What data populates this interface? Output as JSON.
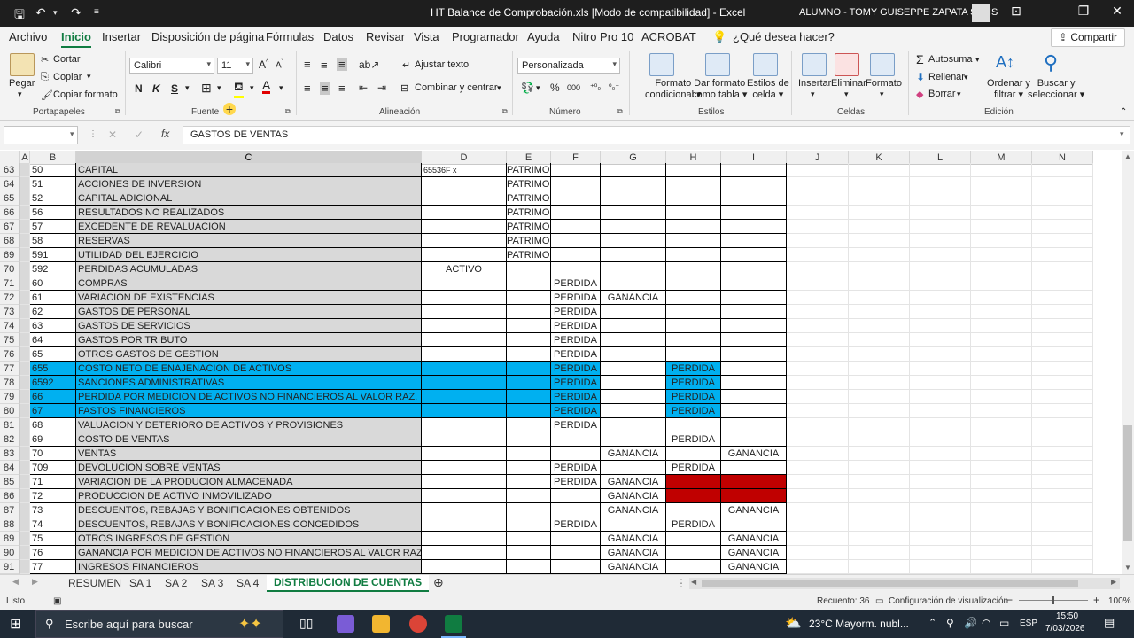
{
  "window": {
    "title": "HT Balance de Comprobación.xls  [Modo de compatibilidad]  -  Excel",
    "user": "ALUMNO - TOMY GUISEPPE ZAPATA SALIS"
  },
  "menu": [
    "Archivo",
    "Inicio",
    "Insertar",
    "Disposición de página",
    "Fórmulas",
    "Datos",
    "Revisar",
    "Vista",
    "Programador",
    "Ayuda",
    "Nitro Pro 10",
    "ACROBAT",
    "¿Qué desea hacer?"
  ],
  "share": "Compartir",
  "ribbon": {
    "paste": "Pegar",
    "cut": "Cortar",
    "copy": "Copiar",
    "format_painter": "Copiar formato",
    "font_name": "Calibri",
    "font_size": "11",
    "bold": "N",
    "italic": "K",
    "underline": "S",
    "wrap": "Ajustar texto",
    "merge": "Combinar y centrar",
    "number_format": "Personalizada",
    "cond_fmt": [
      "Formato",
      "condicional"
    ],
    "table_fmt": [
      "Dar formato",
      "como tabla"
    ],
    "cell_styles": [
      "Estilos de",
      "celda"
    ],
    "insert": "Insertar",
    "delete": "Eliminar",
    "format": "Formato",
    "autosum": "Autosuma",
    "fill": "Rellenar",
    "clear": "Borrar",
    "sort": [
      "Ordenar y",
      "filtrar"
    ],
    "find": [
      "Buscar y",
      "seleccionar"
    ],
    "groups": [
      "Portapapeles",
      "Fuente",
      "Alineación",
      "Número",
      "Estilos",
      "Celdas",
      "Edición"
    ]
  },
  "formula": {
    "name_box": "",
    "content": "GASTOS DE VENTAS",
    "fx": "fx"
  },
  "columns": [
    "A",
    "B",
    "C",
    "D",
    "E",
    "F",
    "G",
    "H",
    "I",
    "J",
    "K",
    "L",
    "M",
    "N"
  ],
  "rows": [
    {
      "n": "63",
      "b": "50",
      "c": "CAPITAL",
      "d": "65536F x",
      "e": "PATRIMONIO"
    },
    {
      "n": "64",
      "b": "51",
      "c": "ACCIONES DE INVERSION",
      "e": "PATRIMONIO"
    },
    {
      "n": "65",
      "b": "52",
      "c": "CAPITAL ADICIONAL",
      "e": "PATRIMONIO"
    },
    {
      "n": "66",
      "b": "56",
      "c": "RESULTADOS NO REALIZADOS",
      "e": "PATRIMONIO"
    },
    {
      "n": "67",
      "b": "57",
      "c": "EXCEDENTE DE REVALUACION",
      "e": "PATRIMONIO"
    },
    {
      "n": "68",
      "b": "58",
      "c": "RESERVAS",
      "e": "PATRIMONIO"
    },
    {
      "n": "69",
      "b": "591",
      "c": "UTILIDAD DEL EJERCICIO",
      "e": "PATRIMONIO"
    },
    {
      "n": "70",
      "b": "592",
      "c": "PERDIDAS ACUMULADAS",
      "d": "ACTIVO"
    },
    {
      "n": "71",
      "b": "60",
      "c": "COMPRAS",
      "f": "PERDIDA"
    },
    {
      "n": "72",
      "b": "61",
      "c": "VARIACION DE EXISTENCIAS",
      "f": "PERDIDA",
      "g": "GANANCIA"
    },
    {
      "n": "73",
      "b": "62",
      "c": "GASTOS DE PERSONAL",
      "f": "PERDIDA"
    },
    {
      "n": "74",
      "b": "63",
      "c": "GASTOS DE SERVICIOS",
      "f": "PERDIDA"
    },
    {
      "n": "75",
      "b": "64",
      "c": "GASTOS POR TRIBUTO",
      "f": "PERDIDA"
    },
    {
      "n": "76",
      "b": "65",
      "c": "OTROS GASTOS DE GESTION",
      "f": "PERDIDA"
    },
    {
      "n": "77",
      "b": "655",
      "c": "COSTO NETO DE ENAJENACION DE ACTIVOS",
      "f": "PERDIDA",
      "h": "PERDIDA",
      "hl": "cyan"
    },
    {
      "n": "78",
      "b": "6592",
      "c": "SANCIONES ADMINISTRATIVAS",
      "f": "PERDIDA",
      "h": "PERDIDA",
      "hl": "cyan"
    },
    {
      "n": "79",
      "b": "66",
      "c": "PERDIDA POR MEDICION DE ACTIVOS NO FINANCIEROS AL VALOR RAZ.",
      "f": "PERDIDA",
      "h": "PERDIDA",
      "hl": "cyan"
    },
    {
      "n": "80",
      "b": "67",
      "c": "FASTOS FINANCIEROS",
      "f": "PERDIDA",
      "h": "PERDIDA",
      "hl": "cyan"
    },
    {
      "n": "81",
      "b": "68",
      "c": "VALUACION Y DETERIORO DE ACTIVOS Y PROVISIONES",
      "f": "PERDIDA"
    },
    {
      "n": "82",
      "b": "69",
      "c": "COSTO DE VENTAS",
      "h": "PERDIDA"
    },
    {
      "n": "83",
      "b": "70",
      "c": "VENTAS",
      "g": "GANANCIA",
      "i": "GANANCIA"
    },
    {
      "n": "84",
      "b": "709",
      "c": "DEVOLUCION SOBRE VENTAS",
      "f": "PERDIDA",
      "h": "PERDIDA"
    },
    {
      "n": "85",
      "b": "71",
      "c": "VARIACION DE LA PRODUCION ALMACENADA",
      "f": "PERDIDA",
      "g": "GANANCIA",
      "hl": "red"
    },
    {
      "n": "86",
      "b": "72",
      "c": "PRODUCCION DE ACTIVO INMOVILIZADO",
      "g": "GANANCIA",
      "hl": "red"
    },
    {
      "n": "87",
      "b": "73",
      "c": "DESCUENTOS, REBAJAS Y BONIFICACIONES OBTENIDOS",
      "g": "GANANCIA",
      "i": "GANANCIA"
    },
    {
      "n": "88",
      "b": "74",
      "c": "DESCUENTOS, REBAJAS Y BONIFICACIONES CONCEDIDOS",
      "f": "PERDIDA",
      "h": "PERDIDA"
    },
    {
      "n": "89",
      "b": "75",
      "c": "OTROS INGRESOS DE GESTION",
      "g": "GANANCIA",
      "i": "GANANCIA"
    },
    {
      "n": "90",
      "b": "76",
      "c": "GANANCIA POR MEDICION DE ACTIVOS NO FINANCIEROS AL VALOR RAZ.",
      "g": "GANANCIA",
      "i": "GANANCIA"
    },
    {
      "n": "91",
      "b": "77",
      "c": "INGRESOS FINANCIEROS",
      "g": "GANANCIA",
      "i": "GANANCIA"
    }
  ],
  "sheets": [
    "RESUMEN",
    "SA 1",
    "SA 2",
    "SA 3",
    "SA 4",
    "DISTRIBUCION DE CUENTAS"
  ],
  "active_sheet": "DISTRIBUCION DE CUENTAS",
  "status": {
    "ready": "Listo",
    "count": "Recuento: 36",
    "display": "Configuración de visualización",
    "zoom": "100%"
  },
  "taskbar": {
    "search": "Escribe aquí para buscar",
    "weather": "23°C  Mayorm. nubl...",
    "lang": "ESP",
    "time": "15:50",
    "date": "7/03/2026"
  },
  "colors": {
    "accent": "#107c41",
    "cyan": "#00b0f0",
    "red": "#c00000",
    "gray": "#d9d9d9"
  }
}
